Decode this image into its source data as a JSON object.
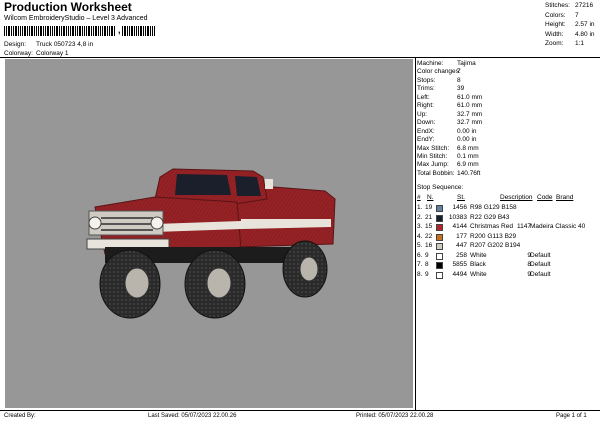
{
  "header": {
    "title": "Production Worksheet",
    "subtitle": "Wilcom EmbroideryStudio – Level 3 Advanced",
    "barcode_suffix": ","
  },
  "meta": {
    "design_label": "Design:",
    "design_value": "Truck 050723 4,8 in",
    "colorway_label": "Colorway:",
    "colorway_value": "Colorway 1"
  },
  "stats": [
    {
      "label": "Stitches:",
      "value": "27216"
    },
    {
      "label": "Colors:",
      "value": "7"
    },
    {
      "label": "Height:",
      "value": "2.57 in"
    },
    {
      "label": "Width:",
      "value": "4.80 in"
    },
    {
      "label": "Zoom:",
      "value": "1:1"
    }
  ],
  "machine_info": [
    {
      "label": "Machine:",
      "value": "Tajima"
    },
    {
      "label": "Color changes:",
      "value": "7"
    },
    {
      "label": "Stops:",
      "value": "8"
    },
    {
      "label": "Trims:",
      "value": "39"
    },
    {
      "label": "Left:",
      "value": "61.0 mm"
    },
    {
      "label": "Right:",
      "value": "61.0 mm"
    },
    {
      "label": "Up:",
      "value": "32.7 mm"
    },
    {
      "label": "Down:",
      "value": "32.7 mm"
    },
    {
      "label": "EndX:",
      "value": "0.00 in"
    },
    {
      "label": "EndY:",
      "value": "0.00 in"
    },
    {
      "label": "Max Stitch:",
      "value": "6.8 mm"
    },
    {
      "label": "Min Stitch:",
      "value": "0.1 mm"
    },
    {
      "label": "Max Jump:",
      "value": "6.9 mm"
    },
    {
      "label": "Total Bobbin:",
      "value": "140.76ft"
    }
  ],
  "stop_sequence": {
    "title": "Stop Sequence:",
    "headers": {
      "n": "#",
      "n2": "N.",
      "st": "St.",
      "code": "Code",
      "desc": "Description",
      "code2": "Code",
      "brand": "Brand"
    },
    "rows": [
      {
        "n": "1.",
        "n2": "19",
        "color": "#627F9E",
        "st": "1456",
        "desc": "R98 G129 B158",
        "code": "",
        "brand": ""
      },
      {
        "n": "2.",
        "n2": "21",
        "color": "#161D2B",
        "st": "10383",
        "desc": "R22 G29 B43",
        "code": "",
        "brand": ""
      },
      {
        "n": "3.",
        "n2": "15",
        "color": "#B3242A",
        "st": "4144",
        "desc": "Christmas Red",
        "code": "1147",
        "brand": "Madeira Classic 40"
      },
      {
        "n": "4.",
        "n2": "22",
        "color": "#C8711D",
        "st": "177",
        "desc": "R200 G113 B29",
        "code": "",
        "brand": ""
      },
      {
        "n": "5.",
        "n2": "16",
        "color": "#CFCAC2",
        "st": "447",
        "desc": "R207 G202 B194",
        "code": "",
        "brand": ""
      },
      {
        "n": "6.",
        "n2": "9",
        "color": "#FFFFFF",
        "st": "258",
        "desc": "White",
        "code": "9",
        "brand": "Default"
      },
      {
        "n": "7.",
        "n2": "8",
        "color": "#000000",
        "st": "5855",
        "desc": "Black",
        "code": "8",
        "brand": "Default"
      },
      {
        "n": "8.",
        "n2": "9",
        "color": "#FFFFFF",
        "st": "4494",
        "desc": "White",
        "code": "9",
        "brand": "Default"
      }
    ]
  },
  "footer": {
    "created_by": "Created By:",
    "last_saved": "Last Saved: 05/07/2023 22.00.26",
    "printed": "Printed: 05/07/2023 22.00.28",
    "page": "Page 1 of 1"
  },
  "colors": {
    "canvas_bg": "#979797",
    "truck_body": "#8E1F22",
    "tire": "#2A2A2A"
  }
}
